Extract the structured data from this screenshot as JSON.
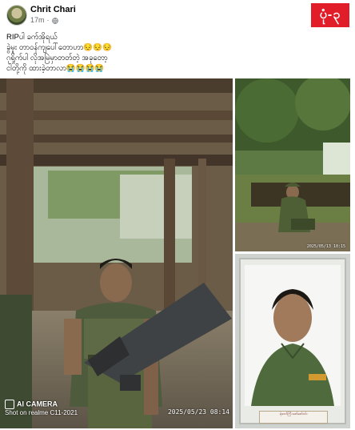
{
  "post": {
    "author": "Chrit Chari",
    "time": "17m",
    "separator": "·",
    "privacy_icon": "globe-icon",
    "badge_text": "ပုံ-၃",
    "badge_color": "#e21d2a",
    "caption_lines": [
      "RIPပါ ခက်အိုရယ်",
      "ခွဲမူး တာဝန်ကျပေါ်တောဟာ😔😔😔",
      "ဂုရှိုက်ပါ လိုအမြဲမှာတတ်တဲ့ အခုတော့",
      "ငါတို့ကို ထားခဲ့တာလာ😭😭😭😭"
    ]
  },
  "photos": {
    "main": {
      "watermark_title": "AI CAMERA",
      "watermark_sub": "Shot on realme C11-2021",
      "timestamp": "2025/05/23  08:14"
    },
    "top_right": {
      "timestamp": "2025/05/13  10:15"
    },
    "bottom_right": {
      "plaque_text": "ရဲဘော်ကြီး ဇော်ဇော်ဝင်း"
    }
  }
}
